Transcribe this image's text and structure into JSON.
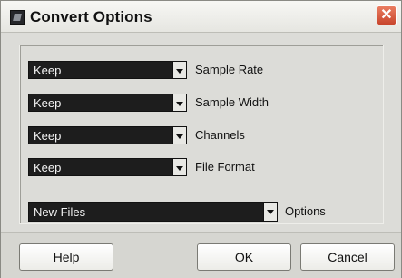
{
  "window": {
    "title": "Convert Options",
    "close_glyph": "✕"
  },
  "settings": [
    {
      "value": "Keep",
      "label": "Sample Rate"
    },
    {
      "value": "Keep",
      "label": "Sample Width"
    },
    {
      "value": "Keep",
      "label": "Channels"
    },
    {
      "value": "Keep",
      "label": "File Format"
    }
  ],
  "options": {
    "value": "New Files",
    "label": "Options"
  },
  "buttons": {
    "help": "Help",
    "ok": "OK",
    "cancel": "Cancel"
  }
}
